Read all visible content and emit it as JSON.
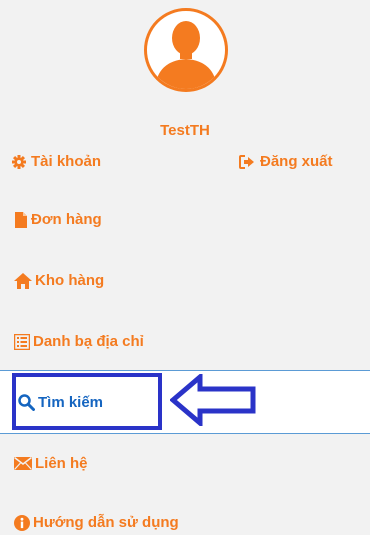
{
  "profile": {
    "username": "TestTH"
  },
  "account": {
    "account_label": "Tài khoản",
    "logout_label": "Đăng xuất"
  },
  "menu": [
    {
      "label": "Đơn hàng",
      "icon": "file-icon"
    },
    {
      "label": "Kho hàng",
      "icon": "home-icon"
    },
    {
      "label": "Danh bạ địa chỉ",
      "icon": "list-icon"
    },
    {
      "label": "Tìm kiếm",
      "icon": "search-icon",
      "active": true
    },
    {
      "label": "Liên hệ",
      "icon": "envelope-icon"
    },
    {
      "label": "Hướng dẫn sử dụng",
      "icon": "info-icon"
    }
  ],
  "colors": {
    "accent": "#f47b20",
    "active_text": "#1565c0",
    "highlight_border": "#2a33c8",
    "row_line": "#5b9bd5"
  }
}
